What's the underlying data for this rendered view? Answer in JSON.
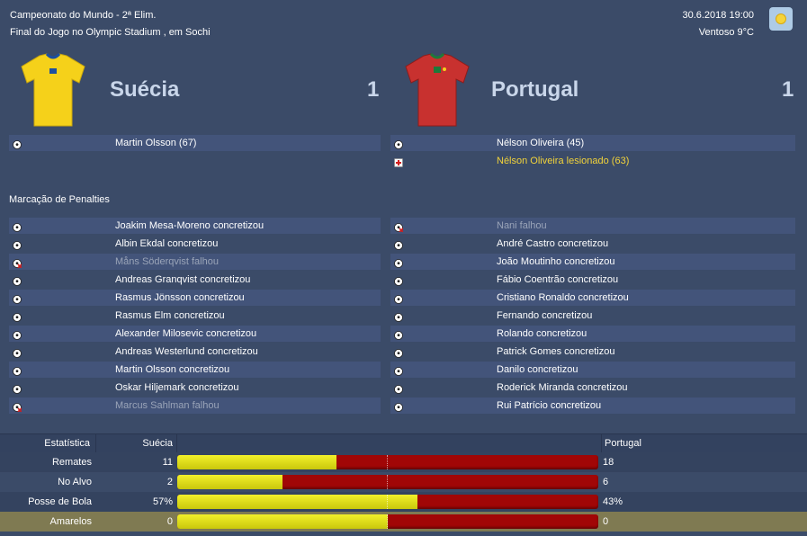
{
  "match": {
    "competition": "Campeonato do Mundo - 2ª Elim.",
    "venue": "Final do Jogo no Olympic Stadium , em Sochi",
    "datetime": "30.6.2018 19:00",
    "weather": "Ventoso 9°C",
    "weather_icon": "sun-icon"
  },
  "home": {
    "name": "Suécia",
    "score": "1",
    "shirt_color": "#f5d11a",
    "shirt_accent": "#1d4fa0",
    "events": [
      {
        "icon": "ball-icon",
        "text": "Martin Olsson (67)",
        "kind": "goal"
      }
    ]
  },
  "away": {
    "name": "Portugal",
    "score": "1",
    "shirt_color": "#c8312f",
    "shirt_accent": "#1e7a3a",
    "events": [
      {
        "icon": "ball-icon",
        "text": "Nélson Oliveira (45)",
        "kind": "goal"
      },
      {
        "icon": "injury-icon",
        "text": "Nélson Oliveira lesionado (63)",
        "kind": "injury"
      }
    ]
  },
  "penalties": {
    "title": "Marcação de Penalties",
    "home": [
      {
        "text": "Joakim Mesa-Moreno concretizou",
        "scored": true
      },
      {
        "text": "Albin Ekdal concretizou",
        "scored": true
      },
      {
        "text": "Måns Söderqvist falhou",
        "scored": false
      },
      {
        "text": "Andreas Granqvist concretizou",
        "scored": true
      },
      {
        "text": "Rasmus Jönsson concretizou",
        "scored": true
      },
      {
        "text": "Rasmus Elm concretizou",
        "scored": true
      },
      {
        "text": "Alexander Milosevic concretizou",
        "scored": true
      },
      {
        "text": "Andreas Westerlund concretizou",
        "scored": true
      },
      {
        "text": "Martin Olsson concretizou",
        "scored": true
      },
      {
        "text": "Oskar Hiljemark concretizou",
        "scored": true
      },
      {
        "text": "Marcus Sahlman falhou",
        "scored": false
      }
    ],
    "away": [
      {
        "text": "Nani falhou",
        "scored": false
      },
      {
        "text": "André Castro concretizou",
        "scored": true
      },
      {
        "text": "João Moutinho concretizou",
        "scored": true
      },
      {
        "text": "Fábio Coentrão concretizou",
        "scored": true
      },
      {
        "text": "Cristiano Ronaldo concretizou",
        "scored": true
      },
      {
        "text": "Fernando concretizou",
        "scored": true
      },
      {
        "text": "Rolando concretizou",
        "scored": true
      },
      {
        "text": "Patrick Gomes concretizou",
        "scored": true
      },
      {
        "text": "Danilo concretizou",
        "scored": true
      },
      {
        "text": "Roderick Miranda concretizou",
        "scored": true
      },
      {
        "text": "Rui Patrício concretizou",
        "scored": true
      }
    ]
  },
  "stats": {
    "header_label": "Estatística",
    "header_home": "Suécia",
    "header_away": "Portugal",
    "rows": [
      {
        "label": "Remates",
        "home": "11",
        "away": "18",
        "home_share": 0.379
      },
      {
        "label": "No Alvo",
        "home": "2",
        "away": "6",
        "home_share": 0.25
      },
      {
        "label": "Posse de Bola",
        "home": "57%",
        "away": "43%",
        "home_share": 0.57
      },
      {
        "label": "Amarelos",
        "home": "0",
        "away": "0",
        "home_share": 0.5
      }
    ]
  },
  "colors": {
    "bar_home": "#f2f02a",
    "bar_away": "#a10606",
    "highlight_row": "#7f7a52"
  }
}
